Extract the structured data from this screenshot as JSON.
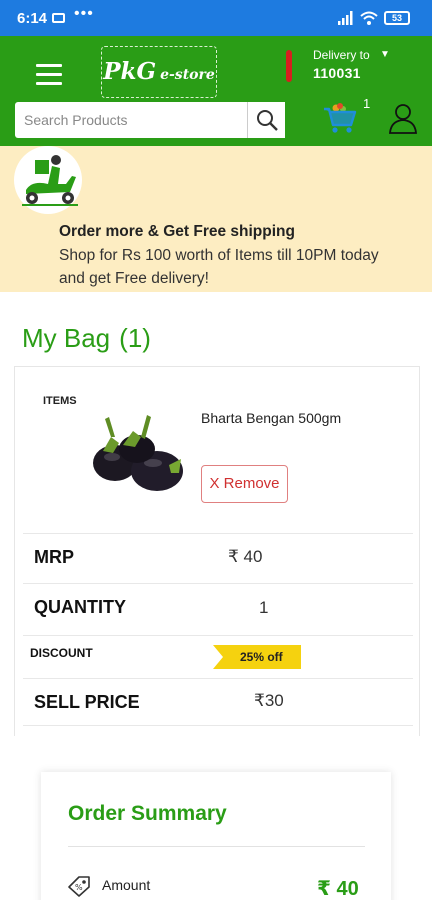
{
  "status_bar": {
    "time": "6:14",
    "more": "•••",
    "battery": "53"
  },
  "header": {
    "logo_main": "PkG",
    "logo_sub": "e-store",
    "delivery_label": "Delivery to",
    "delivery_pincode": "110031",
    "cart_count": "1",
    "brand_color": "#2a9d16"
  },
  "search": {
    "placeholder": "Search Products",
    "value": ""
  },
  "promo": {
    "title": "Order more & Get Free shipping",
    "line1": "Shop for Rs 100 worth of Items till 10PM today",
    "line2": "and get Free delivery!",
    "background": "#fdedc2"
  },
  "bag": {
    "title": "My Bag",
    "count": "(1)",
    "items_label": "ITEMS",
    "item": {
      "name": "Bharta Bengan 500gm",
      "remove_label": "X Remove"
    },
    "rows": {
      "mrp_label": "MRP",
      "mrp_value": "₹ 40",
      "quantity_label": "QUANTITY",
      "quantity_value": "1",
      "discount_label": "DISCOUNT",
      "discount_value": "25% off",
      "sell_price_label": "SELL PRICE",
      "sell_price_value": "₹30"
    }
  },
  "summary": {
    "title": "Order Summary",
    "amount_label": "Amount",
    "amount_value": "₹  40"
  }
}
